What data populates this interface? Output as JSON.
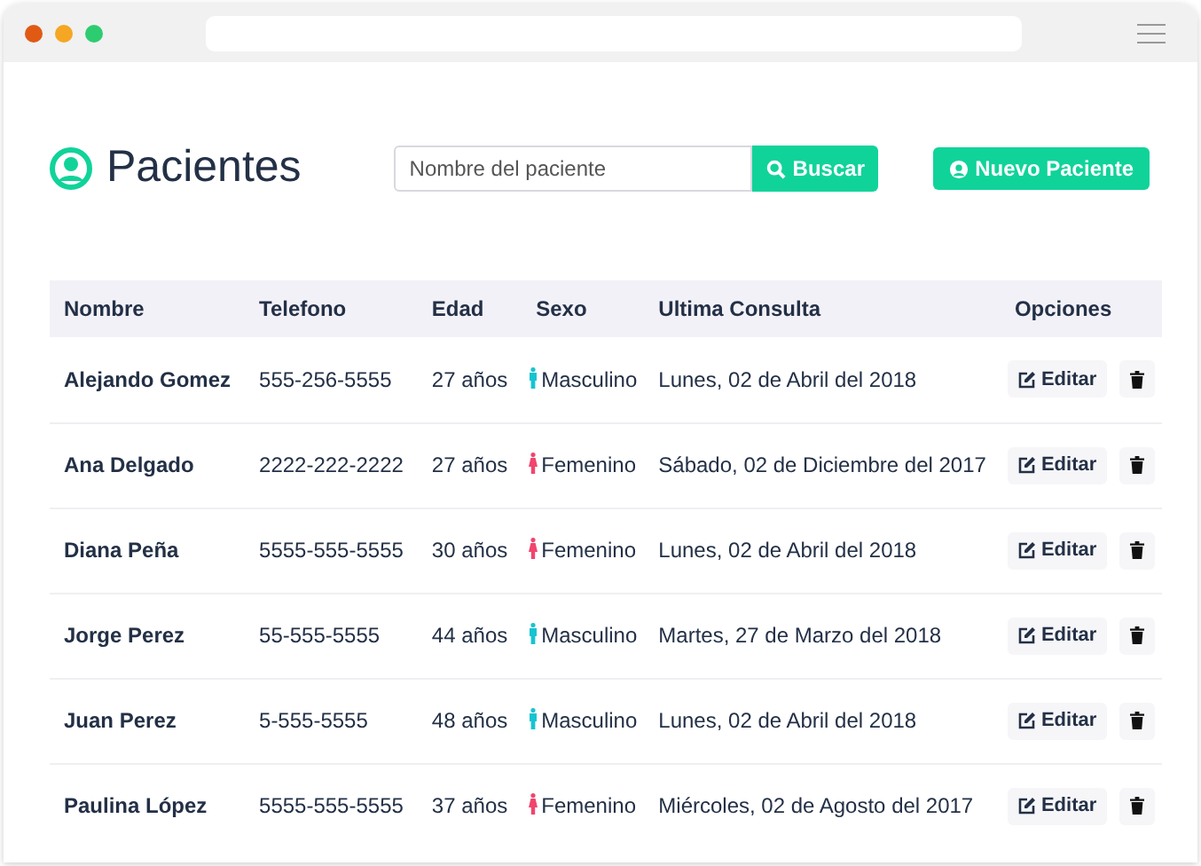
{
  "header": {
    "title": "Pacientes",
    "search": {
      "placeholder": "Nombre del paciente",
      "button": "Buscar"
    },
    "new_button": "Nuevo Paciente"
  },
  "table": {
    "columns": [
      "Nombre",
      "Telefono",
      "Edad",
      "Sexo",
      "Ultima Consulta",
      "Opciones"
    ],
    "rows": [
      {
        "name": "Alejando Gomez",
        "phone": "555-256-5555",
        "age": "27 años",
        "sex": {
          "kind": "male",
          "label": "Masculino"
        },
        "last_visit": "Lunes, 02 de Abril del 2018",
        "edit": "Editar"
      },
      {
        "name": "Ana Delgado",
        "phone": "2222-222-2222",
        "age": "27 años",
        "sex": {
          "kind": "female",
          "label": "Femenino"
        },
        "last_visit": "Sábado, 02 de Diciembre del 2017",
        "edit": "Editar"
      },
      {
        "name": "Diana Peña",
        "phone": "5555-555-5555",
        "age": "30 años",
        "sex": {
          "kind": "female",
          "label": "Femenino"
        },
        "last_visit": "Lunes, 02 de Abril del 2018",
        "edit": "Editar"
      },
      {
        "name": "Jorge Perez",
        "phone": "55-555-5555",
        "age": "44 años",
        "sex": {
          "kind": "male",
          "label": "Masculino"
        },
        "last_visit": "Martes, 27 de Marzo del 2018",
        "edit": "Editar"
      },
      {
        "name": "Juan Perez",
        "phone": "5-555-5555",
        "age": "48 años",
        "sex": {
          "kind": "male",
          "label": "Masculino"
        },
        "last_visit": "Lunes, 02 de Abril del 2018",
        "edit": "Editar"
      },
      {
        "name": "Paulina López",
        "phone": "5555-555-5555",
        "age": "37 años",
        "sex": {
          "kind": "female",
          "label": "Femenino"
        },
        "last_visit": "Miércoles, 02 de Agosto del 2017",
        "edit": "Editar"
      }
    ]
  }
}
